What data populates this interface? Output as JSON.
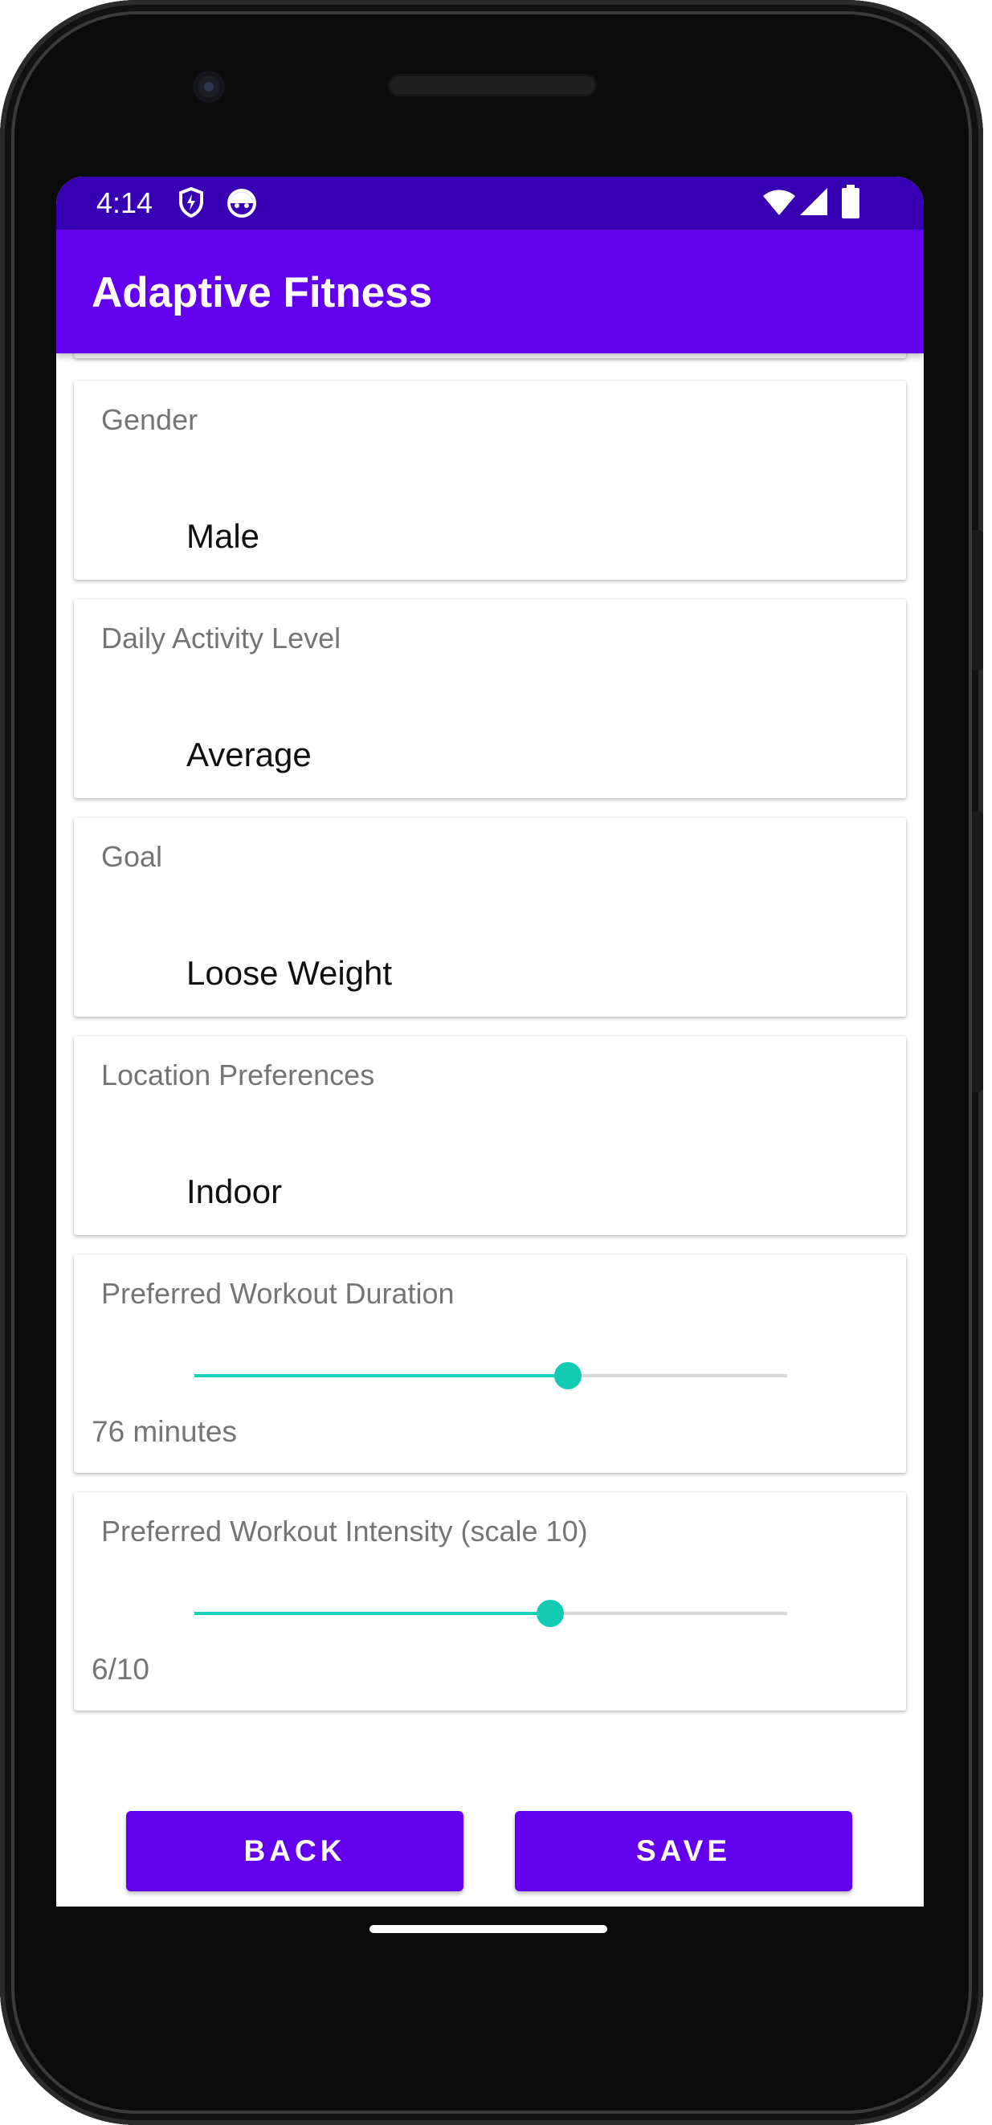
{
  "status_bar": {
    "time": "4:14",
    "icons": [
      "shield-icon",
      "android-face-icon",
      "wifi-icon",
      "signal-icon",
      "battery-icon"
    ]
  },
  "app_bar": {
    "title": "Adaptive Fitness"
  },
  "form": {
    "gender": {
      "label": "Gender",
      "value": "Male"
    },
    "activity": {
      "label": "Daily Activity Level",
      "value": "Average"
    },
    "goal": {
      "label": "Goal",
      "value": "Loose Weight"
    },
    "location": {
      "label": "Location Preferences",
      "value": "Indoor"
    },
    "duration": {
      "label": "Preferred Workout Duration",
      "slider_fraction": 0.63,
      "readout": "76 minutes"
    },
    "intensity": {
      "label": "Preferred Workout Intensity (scale 10)",
      "slider_fraction": 0.6,
      "readout": "6/10"
    }
  },
  "buttons": {
    "back": "BACK",
    "save": "SAVE"
  },
  "colors": {
    "status_bar": "#3700b3",
    "app_bar": "#6200ee",
    "slider_accent": "#13cbb2",
    "button": "#6200ee"
  }
}
